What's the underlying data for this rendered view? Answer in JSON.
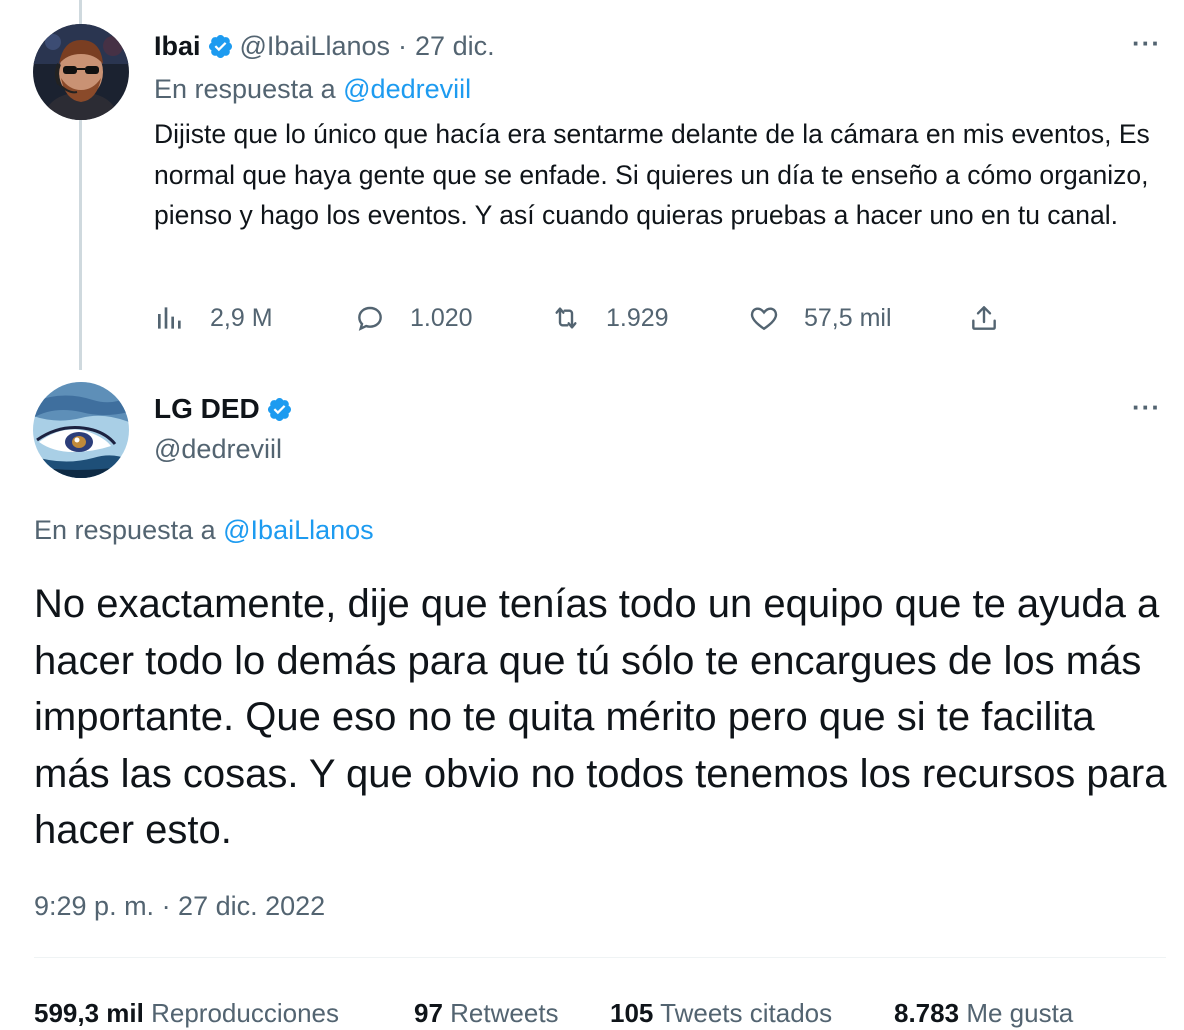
{
  "tweet1": {
    "name": "Ibai",
    "handle": "@IbaiLlanos",
    "separator": "·",
    "date": "27 dic.",
    "reply_prefix": "En respuesta a",
    "reply_to": "@dedreviil",
    "text": "Dijiste que lo único que hacía era sentarme delante de la cámara en mis eventos, Es normal que haya gente que se enfade. Si quieres un día te enseño a cómo organizo, pienso y hago los eventos. Y así cuando quieras pruebas a hacer uno en tu canal.",
    "more": "···",
    "actions": {
      "views": "2,9 M",
      "replies": "1.020",
      "retweets": "1.929",
      "likes": "57,5 mil"
    }
  },
  "tweet2": {
    "name": "LG DED",
    "handle": "@dedreviil",
    "more": "···",
    "reply_prefix": "En respuesta a",
    "reply_to": "@IbaiLlanos",
    "text": "No exactamente, dije que tenías todo un equipo que te ayuda a hacer todo lo demás para que tú sólo te encargues de los más importante. Que eso no te quita mérito pero que si te facilita más las cosas. Y que obvio no todos tenemos los recursos para hacer esto.",
    "timestamp": "9:29 p. m. · 27 dic. 2022",
    "stats": {
      "views_value": "599,3 mil",
      "views_label": "Reproducciones",
      "retweets_value": "97",
      "retweets_label": "Retweets",
      "quotes_value": "105",
      "quotes_label": "Tweets citados",
      "likes_value": "8.783",
      "likes_label": "Me gusta"
    }
  },
  "icons": {
    "verified": "verified-badge-icon",
    "views": "bar-chart-icon",
    "reply": "speech-bubble-icon",
    "retweet": "retweet-arrows-icon",
    "like": "heart-icon",
    "share": "share-upload-icon"
  },
  "colors": {
    "accent": "#1d9bf0",
    "text": "#0f1419",
    "muted": "#536471",
    "thread_line": "#cfd9de"
  }
}
